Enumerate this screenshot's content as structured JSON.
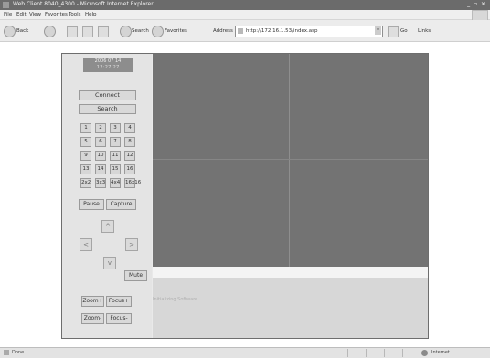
{
  "window": {
    "title": "Web Client 8040_4300 - Microsoft Internet Explorer",
    "controls": "_ ▫ ×"
  },
  "menu": [
    "File",
    "Edit",
    "View",
    "Favorites",
    "Tools",
    "Help"
  ],
  "toolbar": {
    "back": "Back",
    "search": "Search",
    "favorites": "Favorites",
    "address_label": "Address",
    "url": "http://172.16.1.53/index.asp",
    "go": "Go",
    "links": "Links"
  },
  "clock": {
    "date": "2006 07 14",
    "time": "12:27:27"
  },
  "buttons": {
    "connect": "Connect",
    "search": "Search",
    "pause": "Pause",
    "capture": "Capture",
    "mute": "Mute",
    "zoom_plus": "Zoom+",
    "focus_plus": "Focus+",
    "zoom_minus": "Zoom-",
    "focus_minus": "Focus-"
  },
  "channels": [
    "1",
    "2",
    "3",
    "4",
    "5",
    "6",
    "7",
    "8",
    "9",
    "10",
    "11",
    "12",
    "13",
    "14",
    "15",
    "16"
  ],
  "split_modes": [
    "2x2",
    "3x3",
    "4x4",
    "16x16"
  ],
  "ptz": {
    "up": "^",
    "left": "<",
    "right": ">",
    "down": "v"
  },
  "message": "Initializing Software",
  "status": {
    "done": "Done",
    "zone": "Internet"
  },
  "colors": {
    "video_background": "#737373",
    "panel_background": "#e4e4e4"
  }
}
